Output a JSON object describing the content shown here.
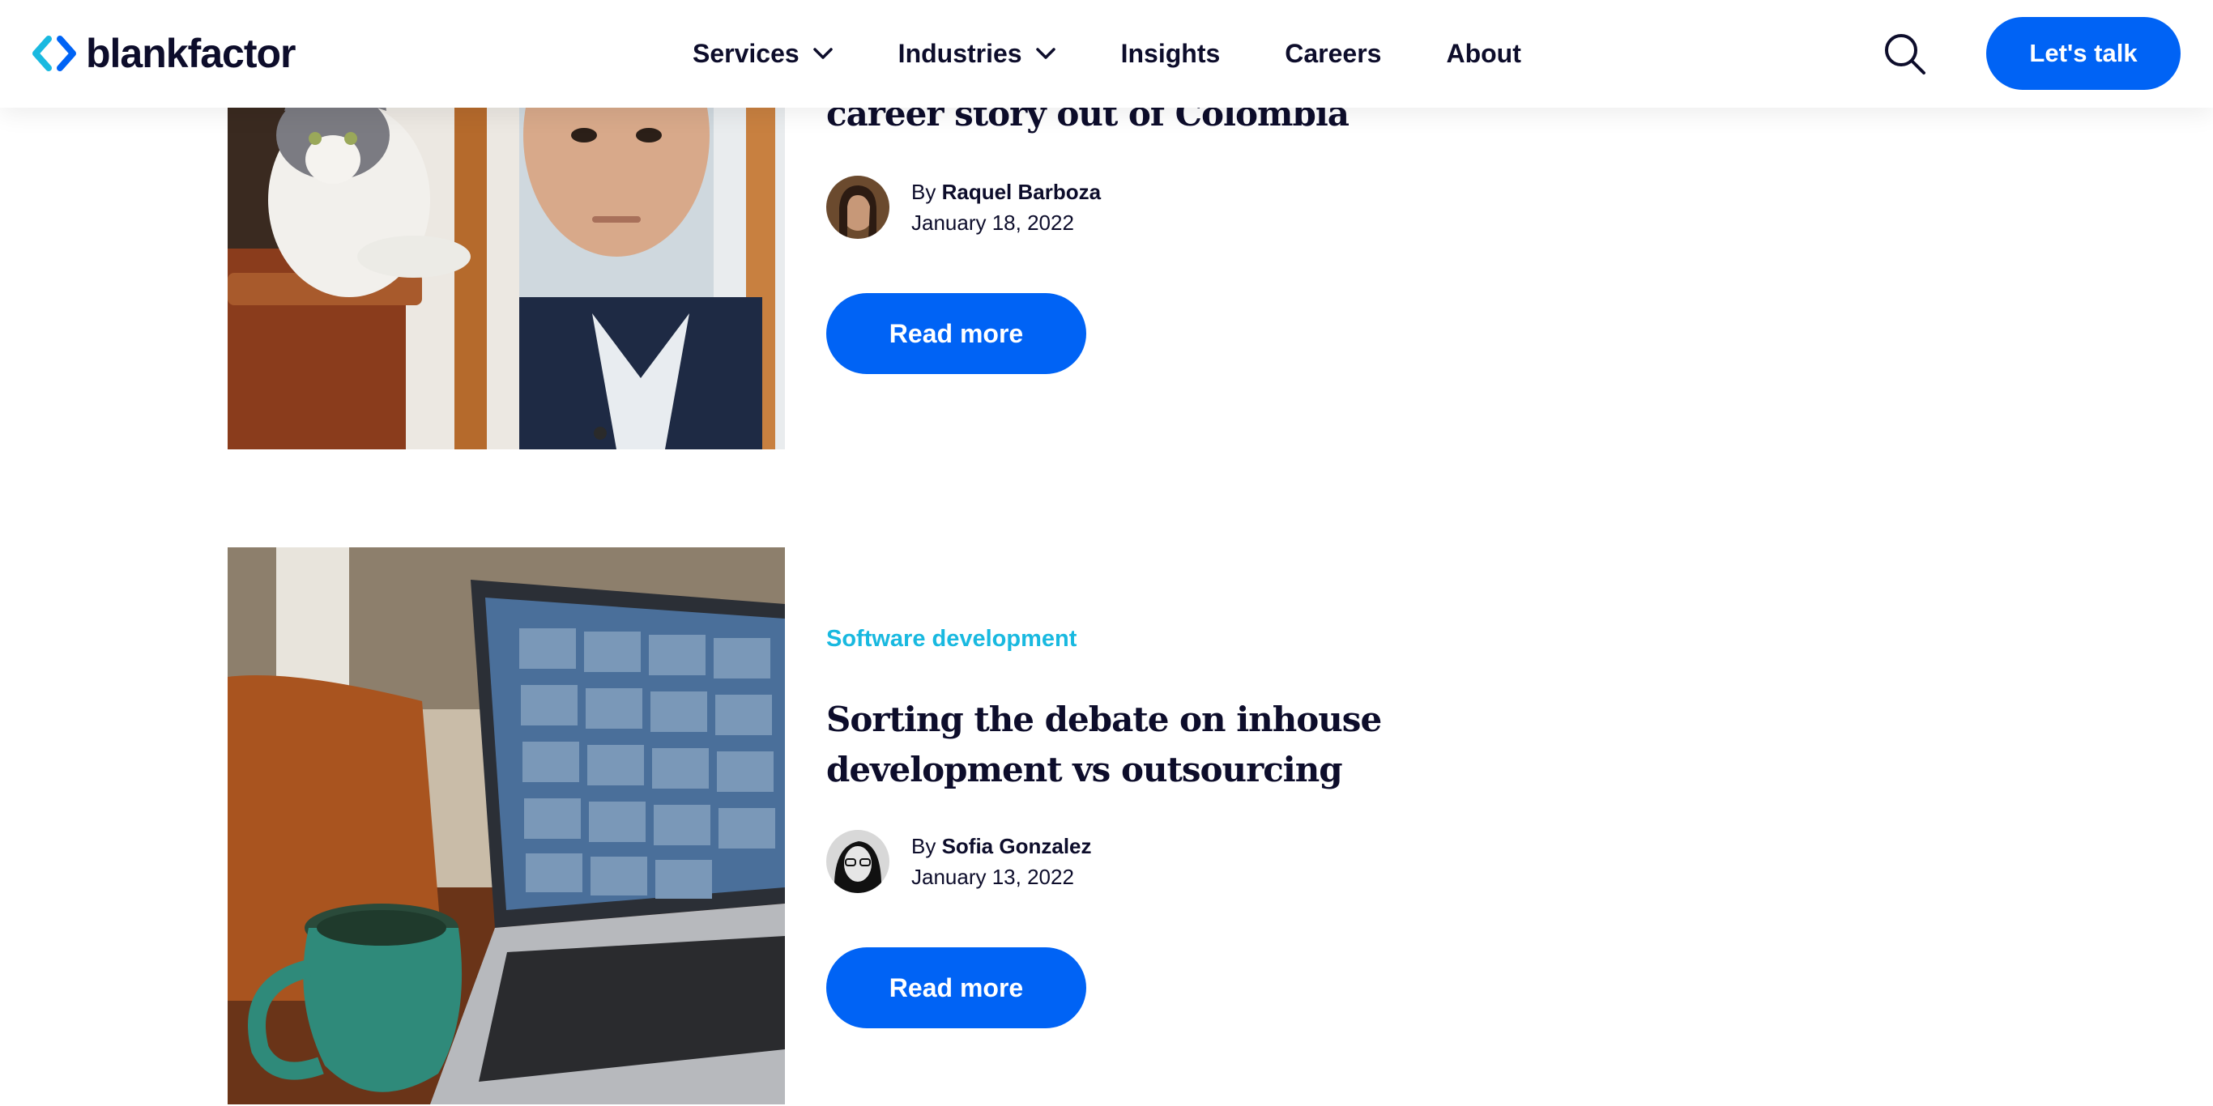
{
  "header": {
    "logo_text": "blankfactor",
    "nav": [
      {
        "label": "Services"
      },
      {
        "label": "Industries"
      },
      {
        "label": "Insights"
      },
      {
        "label": "Careers"
      },
      {
        "label": "About"
      }
    ],
    "cta_label": "Let's talk"
  },
  "colors": {
    "brand_blue": "#0063f5",
    "accent_cyan": "#19b9e0",
    "text_dark": "#0d0d2b"
  },
  "articles": [
    {
      "title": "career story out of Colombia",
      "author_prefix": "By",
      "author": "Raquel Barboza",
      "date": "January 18, 2022",
      "read_more": "Read more"
    },
    {
      "category": "Software development",
      "title_line1": "Sorting the debate on inhouse",
      "title_line2": "development vs outsourcing",
      "author_prefix": "By",
      "author": "Sofia Gonzalez",
      "date": "January 13, 2022",
      "read_more": "Read more"
    }
  ]
}
